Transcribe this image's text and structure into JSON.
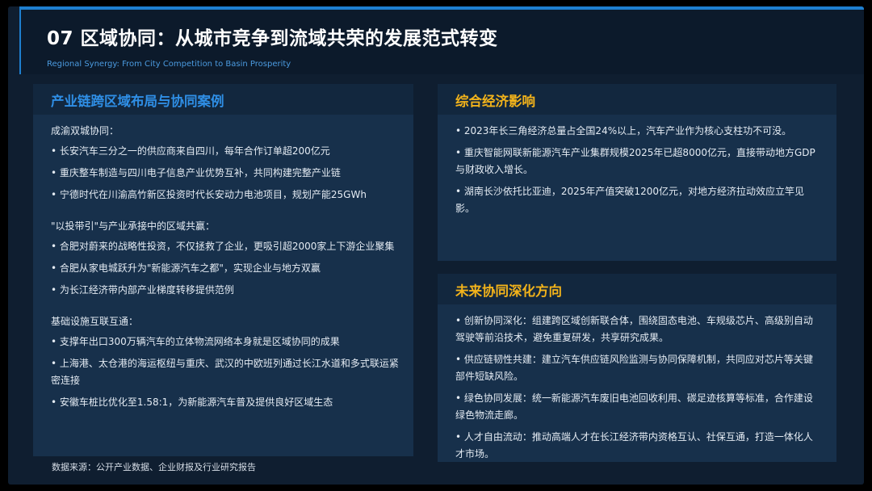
{
  "header": {
    "title": "07  区域协同：从城市竞争到流域共荣的发展范式转变",
    "subtitle": "Regional Synergy: From City Competition to Basin Prosperity"
  },
  "left_panel": {
    "title": "产业链跨区域布局与协同案例",
    "sections": [
      {
        "heading": "成渝双城协同：",
        "items": [
          "• 长安汽车三分之一的供应商来自四川，每年合作订单超200亿元",
          "• 重庆整车制造与四川电子信息产业优势互补，共同构建完整产业链",
          "• 宁德时代在川渝高竹新区投资时代长安动力电池项目，规划产能25GWh"
        ]
      },
      {
        "heading": "\"以投带引\"与产业承接中的区域共赢：",
        "items": [
          "• 合肥对蔚来的战略性投资，不仅拯救了企业，更吸引超2000家上下游企业聚集",
          "• 合肥从家电城跃升为\"新能源汽车之都\"，实现企业与地方双赢",
          "• 为长江经济带内部产业梯度转移提供范例"
        ]
      },
      {
        "heading": "基础设施互联互通：",
        "items": [
          "• 支撑年出口300万辆汽车的立体物流网络本身就是区域协同的成果",
          "• 上海港、太仓港的海运枢纽与重庆、武汉的中欧班列通过长江水道和多式联运紧密连接",
          "• 安徽车桩比优化至1.58:1，为新能源汽车普及提供良好区域生态"
        ]
      }
    ]
  },
  "right_top_panel": {
    "title": "综合经济影响",
    "items": [
      "• 2023年长三角经济总量占全国24%以上，汽车产业作为核心支柱功不可没。",
      "• 重庆智能网联新能源汽车产业集群规模2025年已超8000亿元，直接带动地方GDP与财政收入增长。",
      "• 湖南长沙依托比亚迪，2025年产值突破1200亿元，对地方经济拉动效应立竿见影。"
    ]
  },
  "right_bottom_panel": {
    "title": "未来协同深化方向",
    "items": [
      "• 创新协同深化：组建跨区域创新联合体，围绕固态电池、车规级芯片、高级别自动驾驶等前沿技术，避免重复研发，共享研究成果。",
      "• 供应链韧性共建：建立汽车供应链风险监测与协同保障机制，共同应对芯片等关键部件短缺风险。",
      "• 绿色协同发展：统一新能源汽车废旧电池回收利用、碳足迹核算等标准，合作建设绿色物流走廊。",
      "• 人才自由流动：推动高端人才在长江经济带内资格互认、社保互通，打造一体化人才市场。"
    ]
  },
  "footer": {
    "source": "数据来源：公开产业数据、企业财报及行业研究报告"
  },
  "colors": {
    "left_title": "#2f8fe6",
    "right_title": "#f2b31b",
    "accent_border": "#1e7fcf"
  }
}
